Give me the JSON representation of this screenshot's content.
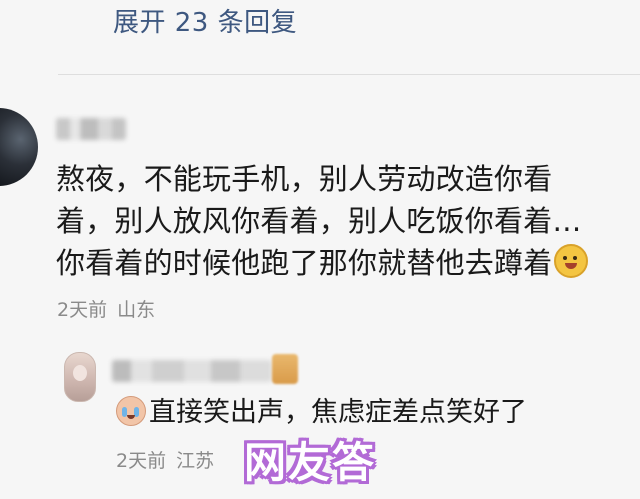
{
  "thread": {
    "expand_replies_label": "展开 23 条回复"
  },
  "comment": {
    "avatar": "user-avatar-dark",
    "username_redacted": true,
    "text_lines": [
      "熬夜，不能玩手机，别人劳动改造你看",
      "着，别人放风你看着，别人吃饭你看着…",
      "你看着的时候他跑了那你就替他去蹲着"
    ],
    "trailing_emoji": "laughing-sticker",
    "time": "2天前",
    "location": "山东"
  },
  "reply": {
    "avatar": "user-avatar-portrait",
    "username_redacted": true,
    "badge": "cat-badge",
    "leading_emoji": "crying-laughing-emoji",
    "text": "直接笑出声，焦虑症差点笑好了",
    "time": "2天前",
    "location": "江苏"
  },
  "overlay": {
    "caption": "网友答",
    "outline_color": "#b26ad6"
  },
  "colors": {
    "link": "#3e5880",
    "meta": "#8a8a8a",
    "background": "#f6f6f6"
  }
}
